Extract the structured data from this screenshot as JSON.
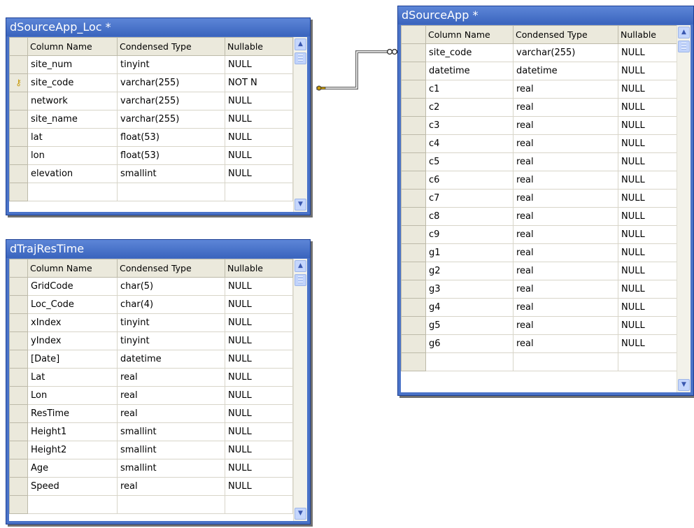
{
  "columns_header": {
    "name": "Column Name",
    "type": "Condensed Type",
    "nullable": "Nullable"
  },
  "tables": [
    {
      "title": "dSourceApp_Loc *",
      "rows": [
        {
          "name": "site_num",
          "type": "tinyint",
          "nullable": "NULL"
        },
        {
          "name": "site_code",
          "type": "varchar(255)",
          "nullable": "NOT N",
          "primary_key": true
        },
        {
          "name": "network",
          "type": "varchar(255)",
          "nullable": "NULL"
        },
        {
          "name": "site_name",
          "type": "varchar(255)",
          "nullable": "NULL"
        },
        {
          "name": "lat",
          "type": "float(53)",
          "nullable": "NULL"
        },
        {
          "name": "lon",
          "type": "float(53)",
          "nullable": "NULL"
        },
        {
          "name": "elevation",
          "type": "smallint",
          "nullable": "NULL"
        },
        {
          "name": "",
          "type": "",
          "nullable": ""
        }
      ]
    },
    {
      "title": "dSourceApp *",
      "rows": [
        {
          "name": "site_code",
          "type": "varchar(255)",
          "nullable": "NULL"
        },
        {
          "name": "datetime",
          "type": "datetime",
          "nullable": "NULL"
        },
        {
          "name": "c1",
          "type": "real",
          "nullable": "NULL"
        },
        {
          "name": "c2",
          "type": "real",
          "nullable": "NULL"
        },
        {
          "name": "c3",
          "type": "real",
          "nullable": "NULL"
        },
        {
          "name": "c4",
          "type": "real",
          "nullable": "NULL"
        },
        {
          "name": "c5",
          "type": "real",
          "nullable": "NULL"
        },
        {
          "name": "c6",
          "type": "real",
          "nullable": "NULL"
        },
        {
          "name": "c7",
          "type": "real",
          "nullable": "NULL"
        },
        {
          "name": "c8",
          "type": "real",
          "nullable": "NULL"
        },
        {
          "name": "c9",
          "type": "real",
          "nullable": "NULL"
        },
        {
          "name": "g1",
          "type": "real",
          "nullable": "NULL"
        },
        {
          "name": "g2",
          "type": "real",
          "nullable": "NULL"
        },
        {
          "name": "g3",
          "type": "real",
          "nullable": "NULL"
        },
        {
          "name": "g4",
          "type": "real",
          "nullable": "NULL"
        },
        {
          "name": "g5",
          "type": "real",
          "nullable": "NULL"
        },
        {
          "name": "g6",
          "type": "real",
          "nullable": "NULL"
        },
        {
          "name": "",
          "type": "",
          "nullable": ""
        }
      ]
    },
    {
      "title": "dTrajResTime",
      "rows": [
        {
          "name": "GridCode",
          "type": "char(5)",
          "nullable": "NULL"
        },
        {
          "name": "Loc_Code",
          "type": "char(4)",
          "nullable": "NULL"
        },
        {
          "name": "xIndex",
          "type": "tinyint",
          "nullable": "NULL"
        },
        {
          "name": "yIndex",
          "type": "tinyint",
          "nullable": "NULL"
        },
        {
          "name": "[Date]",
          "type": "datetime",
          "nullable": "NULL"
        },
        {
          "name": "Lat",
          "type": "real",
          "nullable": "NULL"
        },
        {
          "name": "Lon",
          "type": "real",
          "nullable": "NULL"
        },
        {
          "name": "ResTime",
          "type": "real",
          "nullable": "NULL"
        },
        {
          "name": "Height1",
          "type": "smallint",
          "nullable": "NULL"
        },
        {
          "name": "Height2",
          "type": "smallint",
          "nullable": "NULL"
        },
        {
          "name": "Age",
          "type": "smallint",
          "nullable": "NULL"
        },
        {
          "name": "Speed",
          "type": "real",
          "nullable": "NULL"
        },
        {
          "name": "",
          "type": "",
          "nullable": ""
        }
      ]
    }
  ],
  "relationship": {
    "from": "dSourceApp_Loc.site_code",
    "to": "dSourceApp.site_code"
  },
  "icons": {
    "key": "primary-key-icon",
    "scroll_up": "scroll-up-arrow-icon",
    "scroll_down": "scroll-down-arrow-icon"
  },
  "colors": {
    "title_bar": "#4a73c8",
    "header_bg": "#ebe9dc",
    "key_icon": "#c79a0b"
  }
}
